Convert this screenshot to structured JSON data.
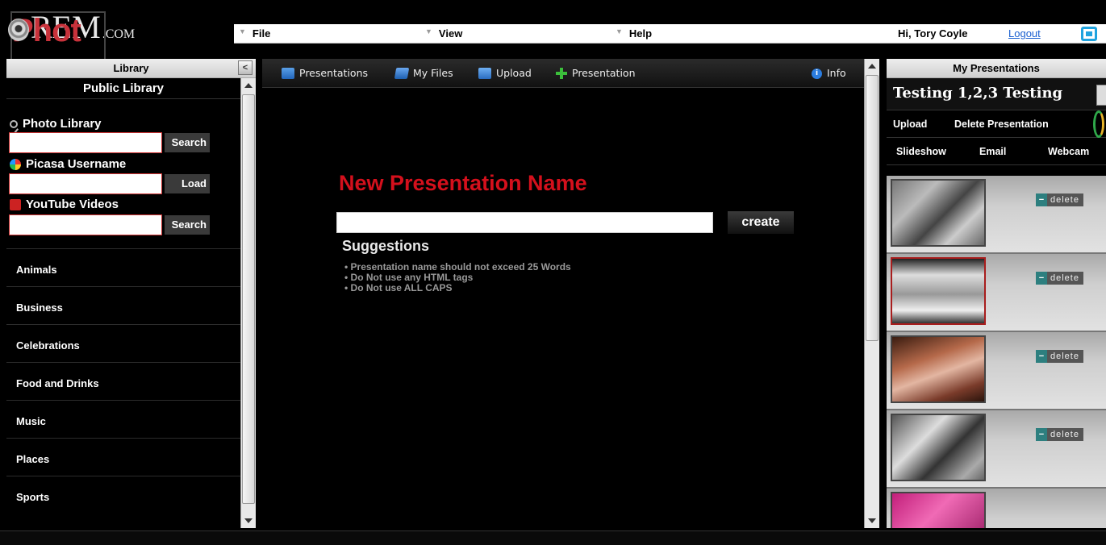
{
  "header": {
    "logo": {
      "photo": "Phot",
      "rem": "REM",
      "com": ".COM"
    },
    "menu": [
      {
        "label": "File"
      },
      {
        "label": "View"
      },
      {
        "label": "Help"
      }
    ],
    "greeting": "Hi, Tory Coyle",
    "logout": "Logout"
  },
  "library": {
    "title": "Library",
    "collapse_icon": "chevron-left-icon",
    "public_library": "Public Library",
    "sources": [
      {
        "label": "Photo Library",
        "icon": "magnifier-icon",
        "button": "Search"
      },
      {
        "label": "Picasa Username",
        "icon": "picasa-icon",
        "button": "Load"
      },
      {
        "label": "YouTube Videos",
        "icon": "youtube-icon",
        "button": "Search"
      }
    ],
    "categories": [
      "Animals",
      "Business",
      "Celebrations",
      "Food and Drinks",
      "Music",
      "Places",
      "Sports"
    ]
  },
  "toolbar": {
    "items": [
      {
        "label": "Presentations",
        "icon": "presentations-icon"
      },
      {
        "label": "My Files",
        "icon": "files-icon"
      },
      {
        "label": "Upload",
        "icon": "upload-icon"
      },
      {
        "label": "Presentation",
        "icon": "plus-icon"
      }
    ],
    "info": "Info"
  },
  "new_presentation": {
    "title": "New Presentation Name",
    "input_value": "",
    "create": "create",
    "suggestions_title": "Suggestions",
    "suggestions": [
      "Presentation name should not exceed 25 Words",
      "Do Not use any HTML tags",
      "Do Not use ALL CAPS"
    ]
  },
  "my_presentations": {
    "title": "My Presentations",
    "current": "Testing 1,2,3 Testing",
    "actions_row1": [
      "Upload",
      "Delete Presentation"
    ],
    "actions_row2": [
      "Slideshow",
      "Email",
      "Webcam"
    ],
    "delete_label": "delete",
    "photos": [
      {
        "selected": false
      },
      {
        "selected": true
      },
      {
        "selected": false
      },
      {
        "selected": false
      },
      {
        "selected": false
      }
    ]
  },
  "colors": {
    "brand_red": "#c8323b",
    "title_red": "#d4101c",
    "link_blue": "#1a5fd0"
  }
}
